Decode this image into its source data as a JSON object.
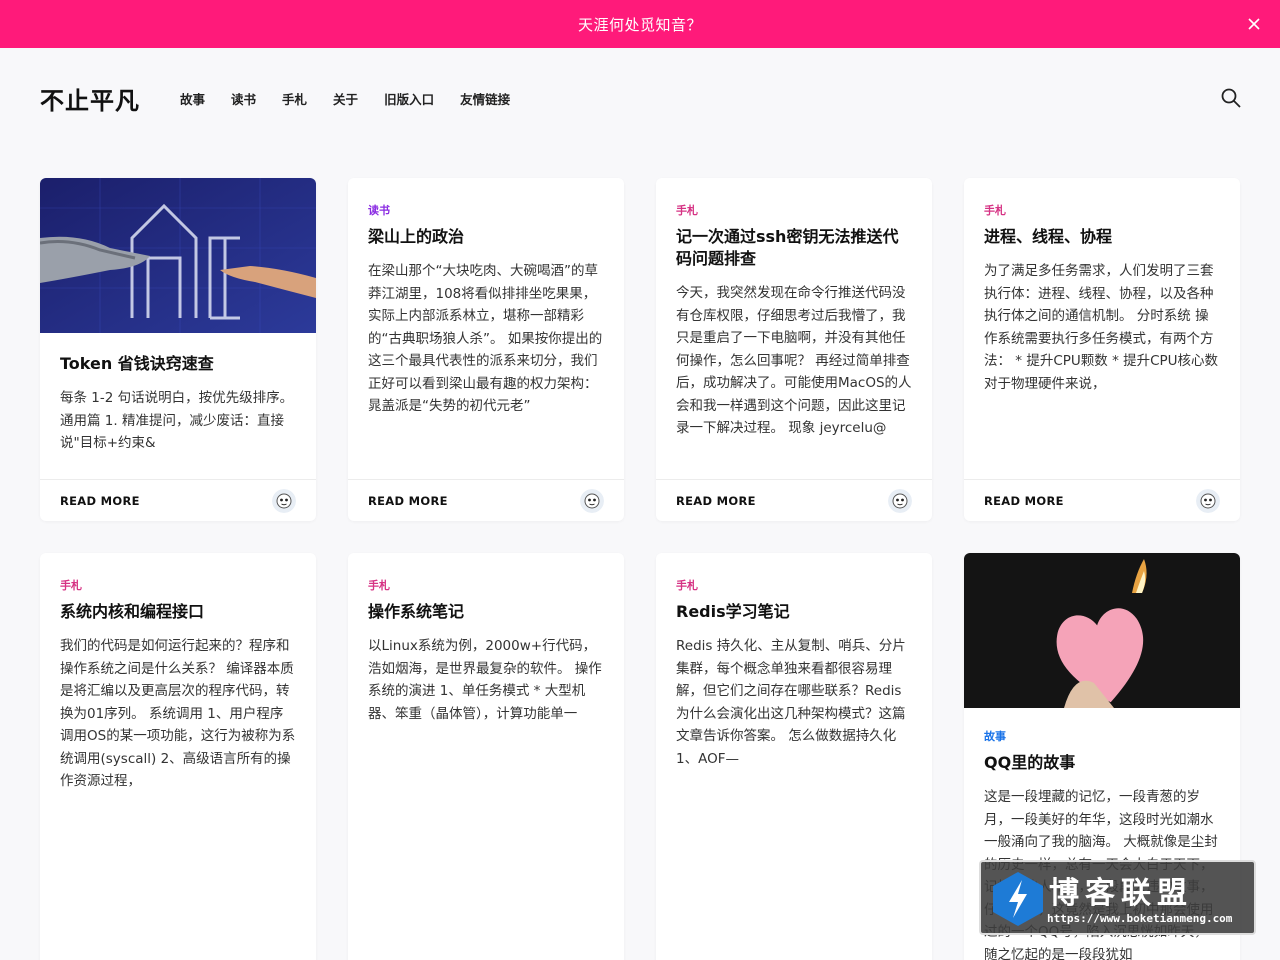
{
  "notice": {
    "text": "天涯何处觅知音？"
  },
  "header": {
    "site_title": "不止平凡",
    "nav": [
      "故事",
      "读书",
      "手札",
      "关于",
      "旧版入口",
      "友情链接"
    ]
  },
  "posts": [
    {
      "category": "",
      "title": "Token 省钱诀窍速查",
      "excerpt": "每条 1-2 句话说明白，按优先级排序。 通用篇 1. 精准提问，减少废话：直接说\"目标+约束&",
      "read_more": "READ MORE"
    },
    {
      "category": "读书",
      "title": "梁山上的政治",
      "excerpt": "在梁山那个“大块吃肉、大碗喝酒”的草莽江湖里，108将看似排排坐吃果果，实际上内部派系林立，堪称一部精彩的“古典职场狼人杀”。 如果按你提出的这三个最具代表性的派系来切分，我们正好可以看到梁山最有趣的权力架构：晁盖派是“失势的初代元老”",
      "read_more": "READ MORE"
    },
    {
      "category": "手札",
      "title": "记一次通过ssh密钥无法推送代码问题排查",
      "excerpt": "今天，我突然发现在命令行推送代码没有仓库权限，仔细思考过后我懵了，我只是重启了一下电脑啊，并没有其他任何操作，怎么回事呢？ 再经过简单排查后，成功解决了。可能使用MacOS的人会和我一样遇到这个问题，因此这里记录一下解决过程。 现象 jeyrcelu@",
      "read_more": "READ MORE"
    },
    {
      "category": "手札",
      "title": "进程、线程、协程",
      "excerpt": "为了满足多任务需求，人们发明了三套执行体：进程、线程、协程，以及各种执行体之间的通信机制。 分时系统 操作系统需要执行多任务模式，有两个方法： * 提升CPU颗数 * 提升CPU核心数 对于物理硬件来说，",
      "read_more": "READ MORE"
    },
    {
      "category": "手札",
      "title": "系统内核和编程接口",
      "excerpt": "我们的代码是如何运行起来的？程序和操作系统之间是什么关系？ 编译器本质是将汇编以及更高层次的程序代码，转换为01序列。 系统调用 1、用户程序调用OS的某一项功能，这行为被称为系统调用(syscall) 2、高级语言所有的操作资源过程，"
    },
    {
      "category": "手札",
      "title": "操作系统笔记",
      "excerpt": "以Linux系统为例，2000w+行代码，浩如烟海，是世界最复杂的软件。 操作系统的演进 1、单任务模式 * 大型机器、笨重（晶体管），计算功能单一"
    },
    {
      "category": "手札",
      "title": "Redis学习笔记",
      "excerpt": "Redis 持久化、主从复制、哨兵、分片集群，每个概念单独来看都很容易理解，但它们之间存在哪些联系？Redis为什么会演化出这几种架构模式？这篇文章告诉你答案。 怎么做数据持久化 1、AOF—"
    },
    {
      "category": "故事",
      "title": "QQ里的故事",
      "excerpt": "这是一段埋藏的记忆，一段青葱的岁月，一段美好的年华，这段时光如潮水一般涌向了我的脑海。 大概就像是尘封的历史一样，总有一天会大白于天下，记忆中的人和事，一段段久违的故事，仔细深究，这竟然是我上初中那会使用过的一个QQ号，陷入沉思恍如昨天，随之忆起的是一段段犹如"
    }
  ],
  "watermark": {
    "title": "博客联盟",
    "url": "https://www.boketianmeng.com"
  },
  "colors": {
    "notice_bg": "#ff1a7a",
    "cat_reading": "#8a2be2",
    "cat_notes": "#d63384",
    "cat_story": "#1a73e8"
  }
}
